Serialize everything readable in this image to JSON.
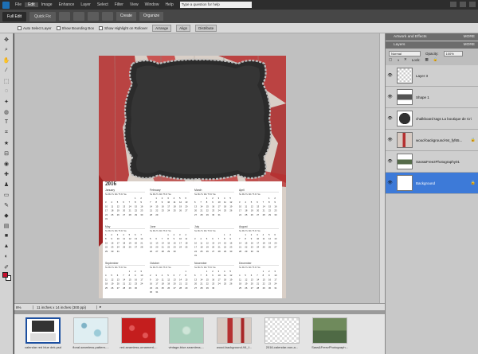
{
  "menu": {
    "items": [
      "File",
      "Edit",
      "Image",
      "Enhance",
      "Layer",
      "Select",
      "Filter",
      "View",
      "Window",
      "Help"
    ],
    "help_placeholder": "Type a question for help"
  },
  "modes": {
    "full_edit": "Full Edit",
    "quick_fix": "Quick Fix",
    "create": "Create",
    "organize": "Organize"
  },
  "options": {
    "auto_select": "Auto Select Layer",
    "bounding_box": "Show Bounding Box",
    "highlight": "Show Highlight on Rollover",
    "arrange": "Arrange",
    "align": "Align",
    "distribute": "Distribute"
  },
  "status": {
    "zoom": "8%",
    "doc_info": "11 inches x 14 inches (300 ppi)"
  },
  "calendar": {
    "year": "2016",
    "days": "Su Mo Tu We Th Fr Sa",
    "months": [
      "January",
      "February",
      "March",
      "April",
      "May",
      "June",
      "July",
      "August",
      "September",
      "October",
      "November",
      "December"
    ]
  },
  "panels": {
    "artwork_title": "Artwork and Effects",
    "layers_title": "Layers",
    "more": "MORE",
    "blend_mode": "Normal",
    "opacity_label": "Opacity:",
    "opacity_value": "100%",
    "lock_label": "Lock:",
    "layers": [
      {
        "name": "Layer 3",
        "selected": false
      },
      {
        "name": "Shape 1",
        "selected": false
      },
      {
        "name": "chalkboard tags La boutique de Cri",
        "selected": false
      },
      {
        "name": "wood-background-94_fyf65...",
        "selected": false
      },
      {
        "name": "Sass&FreezPhotography01",
        "selected": false
      },
      {
        "name": "Background",
        "selected": true
      }
    ]
  },
  "bin": {
    "items": [
      "calendar red blue dek.psd",
      "floral-seamless-pattern-...",
      "red-seamless-ornament-...",
      "vintage-blue-seamless-...",
      "wood-background-94_f...",
      "2016-calendar-non-a...",
      "Sass&FreezPhotograph..."
    ]
  }
}
